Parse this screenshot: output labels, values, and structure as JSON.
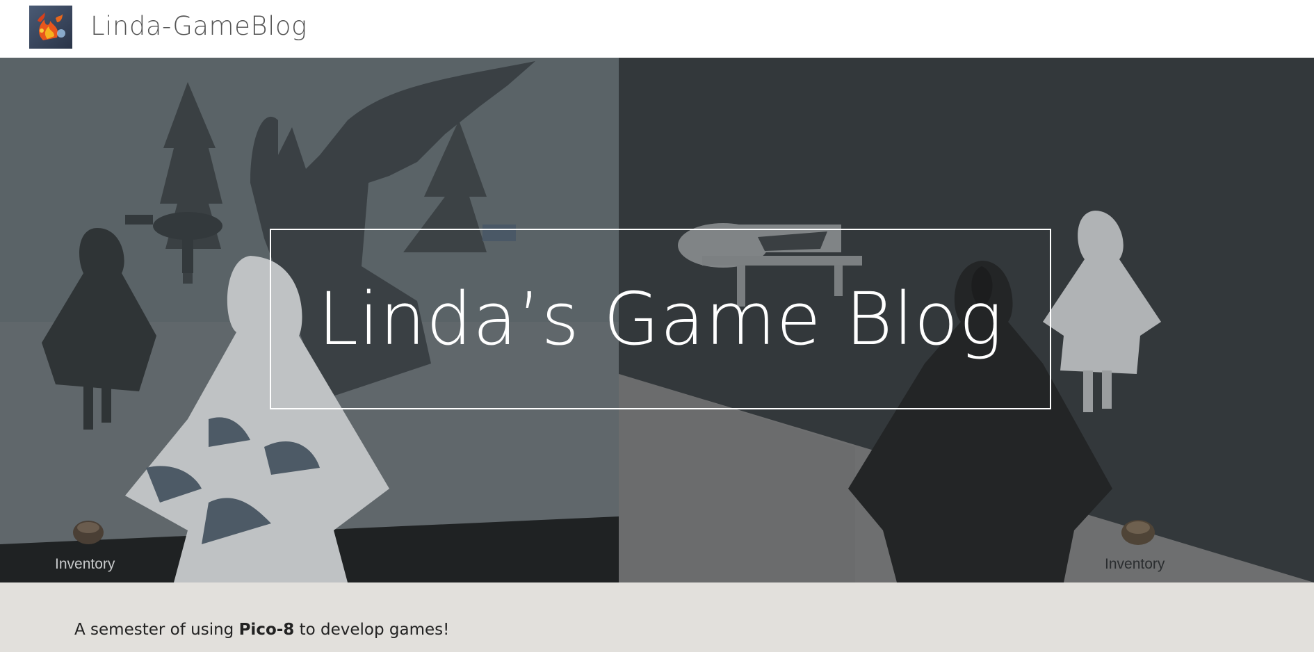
{
  "header": {
    "site_title": "Linda-GameBlog",
    "logo_icon": "flame-logo-icon"
  },
  "hero": {
    "title": "Linda’s Game Blog",
    "inventory_left": "Inventory",
    "inventory_right": "Inventory"
  },
  "intro": {
    "before": "A semester of using ",
    "bold": "Pico-8",
    "after": " to develop games!"
  },
  "colors": {
    "header_bg": "#ffffff",
    "hero_left_bg": "#5f666a",
    "hero_right_bg": "#33383b",
    "content_bg": "#e2e0dc"
  }
}
